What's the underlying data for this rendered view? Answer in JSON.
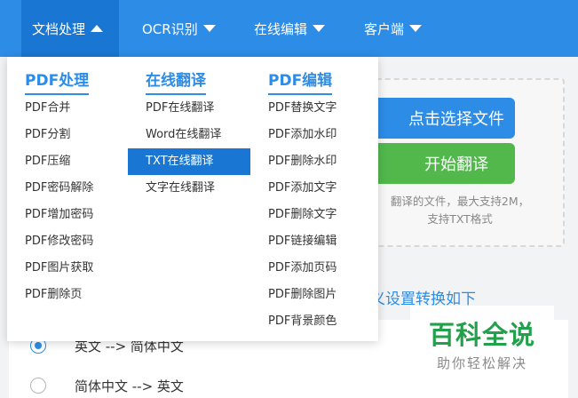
{
  "nav": {
    "items": [
      {
        "label": "文档处理",
        "expanded": true
      },
      {
        "label": "OCR识别",
        "expanded": false
      },
      {
        "label": "在线编辑",
        "expanded": false
      },
      {
        "label": "客户端",
        "expanded": false
      }
    ]
  },
  "menu": {
    "columns": [
      {
        "header": "PDF处理",
        "items": [
          "PDF合并",
          "PDF分割",
          "PDF压缩",
          "PDF密码解除",
          "PDF增加密码",
          "PDF修改密码",
          "PDF图片获取",
          "PDF删除页"
        ]
      },
      {
        "header": "在线翻译",
        "items": [
          "PDF在线翻译",
          "Word在线翻译",
          "TXT在线翻译",
          "文字在线翻译"
        ],
        "selected": "TXT在线翻译"
      },
      {
        "header": "PDF编辑",
        "items": [
          "PDF替换文字",
          "PDF添加水印",
          "PDF删除水印",
          "PDF添加文字",
          "PDF删除文字",
          "PDF链接编辑",
          "PDF添加页码",
          "PDF删除图片",
          "PDF背景颜色"
        ]
      }
    ]
  },
  "upload": {
    "select_button": "点击选择文件",
    "translate_button": "开始翻译",
    "hint_line1": "翻译的文件，最大支持2M，",
    "hint_line2": "支持TXT格式"
  },
  "options": {
    "title": "定义设置转换如下",
    "choices": [
      {
        "label": "英文 --> 简体中文",
        "checked": true
      },
      {
        "label": "简体中文 --> 英文",
        "checked": false
      }
    ]
  },
  "watermark": {
    "logo": "百科全说",
    "slogan": "助你轻松解决"
  },
  "colors": {
    "nav_bg": "#2d8ce6",
    "nav_active": "#1976d2",
    "accent": "#2d8ce6",
    "green_button": "#52b84c",
    "watermark_green": "#22a04b"
  }
}
